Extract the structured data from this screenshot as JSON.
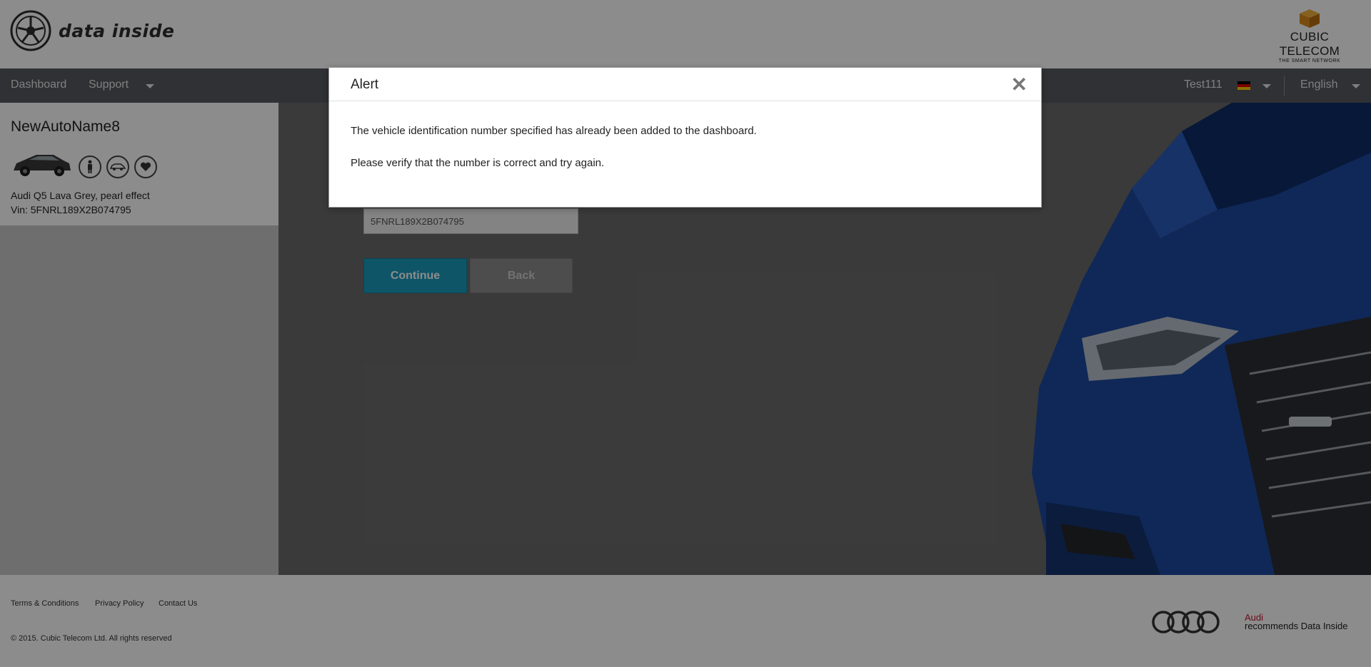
{
  "header": {
    "logo_text": "data inside",
    "partner_logo": {
      "name": "CUBIC TELECOM",
      "tagline": "THE SMART NETWORK"
    }
  },
  "nav": {
    "items": [
      {
        "label": "Dashboard"
      },
      {
        "label": "Support"
      }
    ],
    "user": "Test111",
    "language": "English",
    "flag_icon": "germany-flag-icon"
  },
  "sidebar": {
    "vehicle_name": "NewAutoName8",
    "model": "Audi Q5 Lava Grey, pearl effect",
    "vin_line": "Vin: 5FNRL189X2B074795",
    "icons": [
      "person-icon",
      "car-icon",
      "heart-icon"
    ]
  },
  "form": {
    "vin_value": "5FNRL189X2B074795",
    "continue_label": "Continue",
    "back_label": "Back"
  },
  "modal": {
    "title": "Alert",
    "close_glyph": "✕",
    "message_1": "The vehicle identification number specified has already been added to the dashboard.",
    "message_2": "Please verify that the number is correct and try again."
  },
  "footer": {
    "links": [
      {
        "label": "Terms & Conditions"
      },
      {
        "label": "Privacy Policy"
      },
      {
        "label": "Contact Us"
      }
    ],
    "copyright": "© 2015. Cubic Telecom Ltd. All rights reserved",
    "audi_brand": "Audi",
    "audi_tagline": "recommends Data Inside"
  },
  "colors": {
    "accent": "#1b9bbd",
    "nav_bg": "#575a5f",
    "audi_red": "#c0172d"
  }
}
